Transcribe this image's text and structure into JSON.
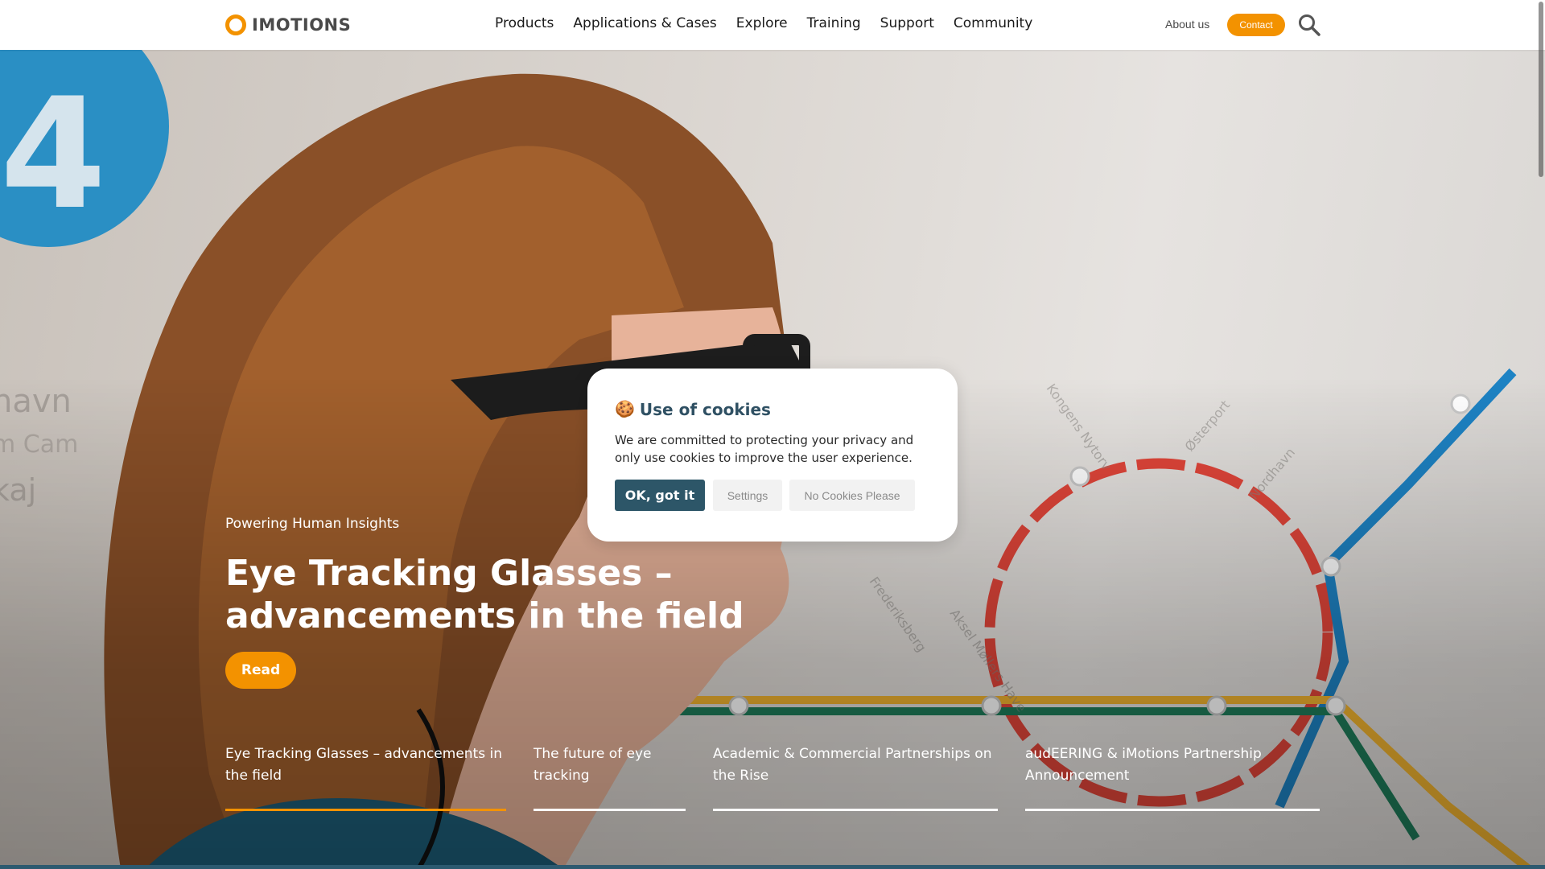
{
  "header": {
    "logo_text": "IMOTIONS",
    "nav": [
      "Products",
      "Applications & Cases",
      "Explore",
      "Training",
      "Support",
      "Community"
    ],
    "about_label": "About us",
    "contact_label": "Contact",
    "search_icon": "search-icon",
    "brand_color": "#f39200"
  },
  "hero": {
    "tagline": "Powering Human Insights",
    "headline": "Eye Tracking Glasses – advancements in the field",
    "read_label": "Read",
    "tabs": [
      {
        "label": "Eye Tracking Glasses – advancements in the field",
        "active": true
      },
      {
        "label": "The future of eye tracking",
        "active": false
      },
      {
        "label": "Academic & Commercial Partnerships on the Rise",
        "active": false
      },
      {
        "label": "audEERING & iMotions Partnership Announcement",
        "active": false
      }
    ]
  },
  "cookie_dialog": {
    "emoji": "🍪",
    "title": "Use of cookies",
    "body": "We are committed to protecting your privacy and only use cookies to improve the user experience.",
    "ok_label": "OK, got it",
    "settings_label": "Settings",
    "no_cookies_label": "No Cookies Please",
    "accent_color": "#2d5668"
  }
}
